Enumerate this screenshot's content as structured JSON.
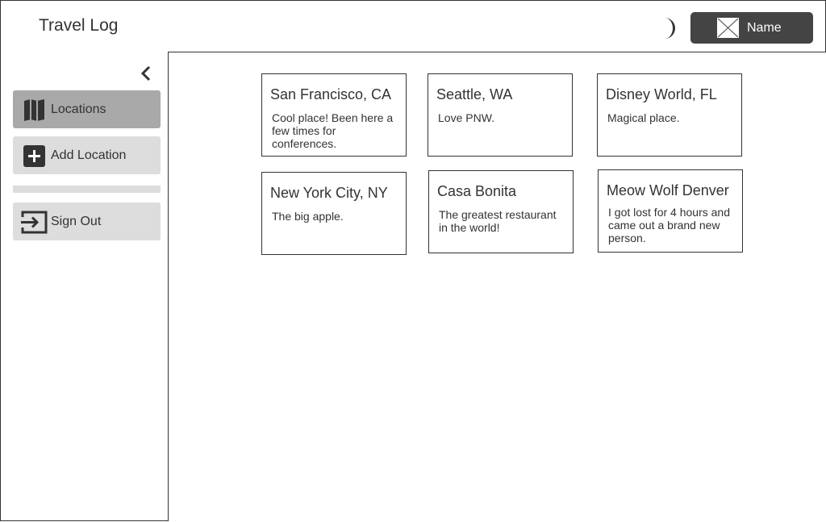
{
  "header": {
    "title": "Travel Log",
    "user_label": "Name"
  },
  "sidebar": {
    "items": [
      {
        "label": "Locations",
        "icon": "map-icon",
        "active": true
      },
      {
        "label": "Add Location",
        "icon": "plus-square-icon",
        "active": false
      },
      {
        "label": "Sign Out",
        "icon": "sign-out-icon",
        "active": false
      }
    ]
  },
  "cards": [
    {
      "title": "San Francisco, CA",
      "desc": "Cool place! Been here a few times for conferences."
    },
    {
      "title": "Seattle, WA",
      "desc": "Love PNW."
    },
    {
      "title": "Disney World, FL",
      "desc": "Magical place."
    },
    {
      "title": "New York City, NY",
      "desc": "The big apple."
    },
    {
      "title": "Casa Bonita",
      "desc": "The greatest restaurant in the world!"
    },
    {
      "title": "Meow Wolf Denver",
      "desc": "I got lost for 4 hours and came out a brand new person."
    }
  ],
  "colors": {
    "accent_dark": "#444444",
    "active_nav": "#a9a9a9",
    "nav_bg": "#dddddd"
  }
}
